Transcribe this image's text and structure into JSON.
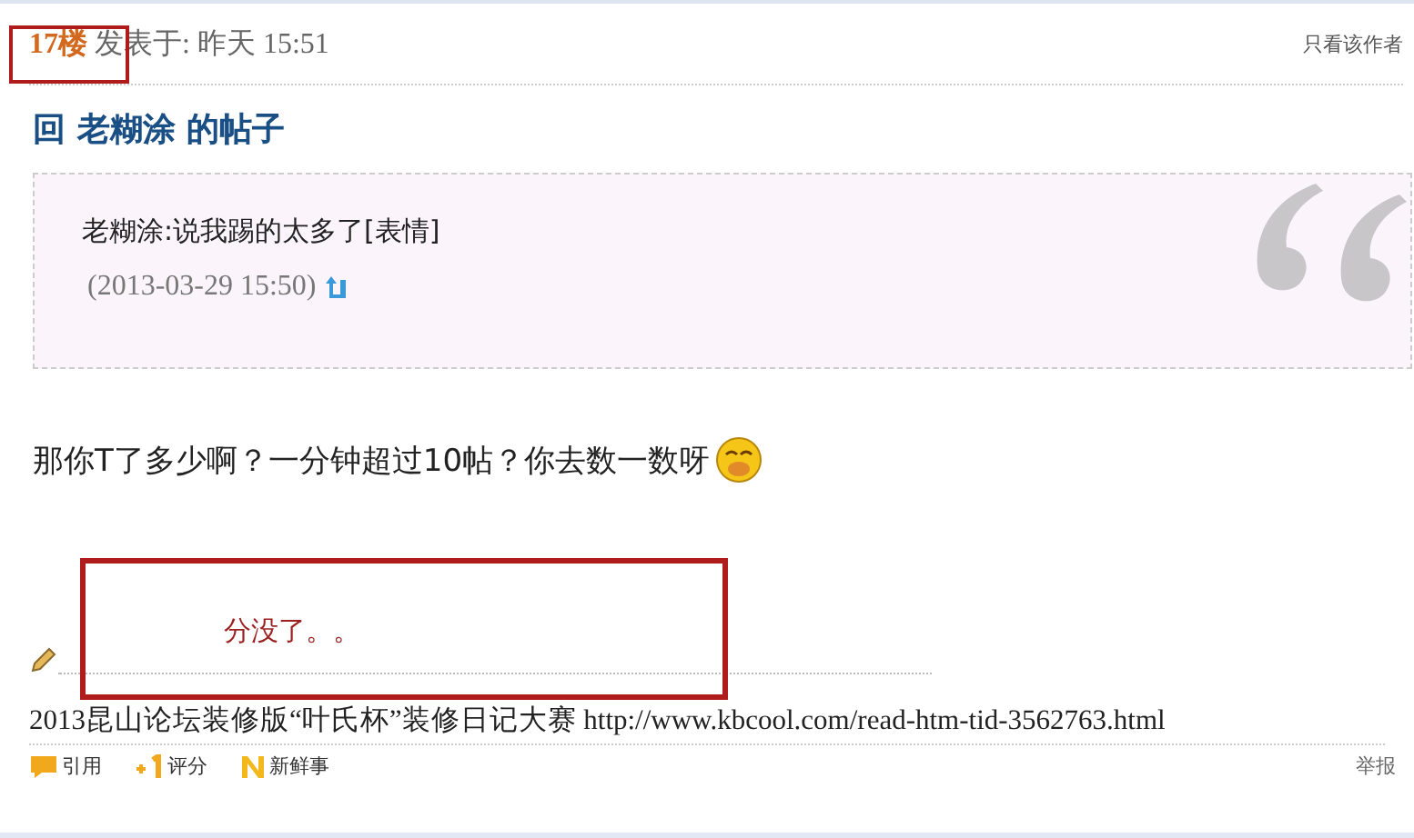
{
  "post": {
    "floor": "17楼",
    "posted_label": "发表于: 昨天 15:51",
    "author_only": "只看该作者",
    "title": "回 老糊涂 的帖子",
    "quote": {
      "text": "老糊涂:说我踢的太多了[表情]",
      "time": "(2013-03-29 15:50)"
    },
    "body": "那你T了多少啊？一分钟超过10帖？你去数一数呀",
    "signature": "2013昆山论坛装修版“叶氏杯”装修日记大赛 http://www.kbcool.com/read-htm-tid-3562763.html",
    "actions": [
      {
        "label": "引用",
        "kind": "quote"
      },
      {
        "label": "评分",
        "kind": "rate"
      },
      {
        "label": "新鲜事",
        "kind": "news"
      }
    ],
    "report": "举报"
  },
  "annotation": {
    "note": "分没了。。"
  }
}
